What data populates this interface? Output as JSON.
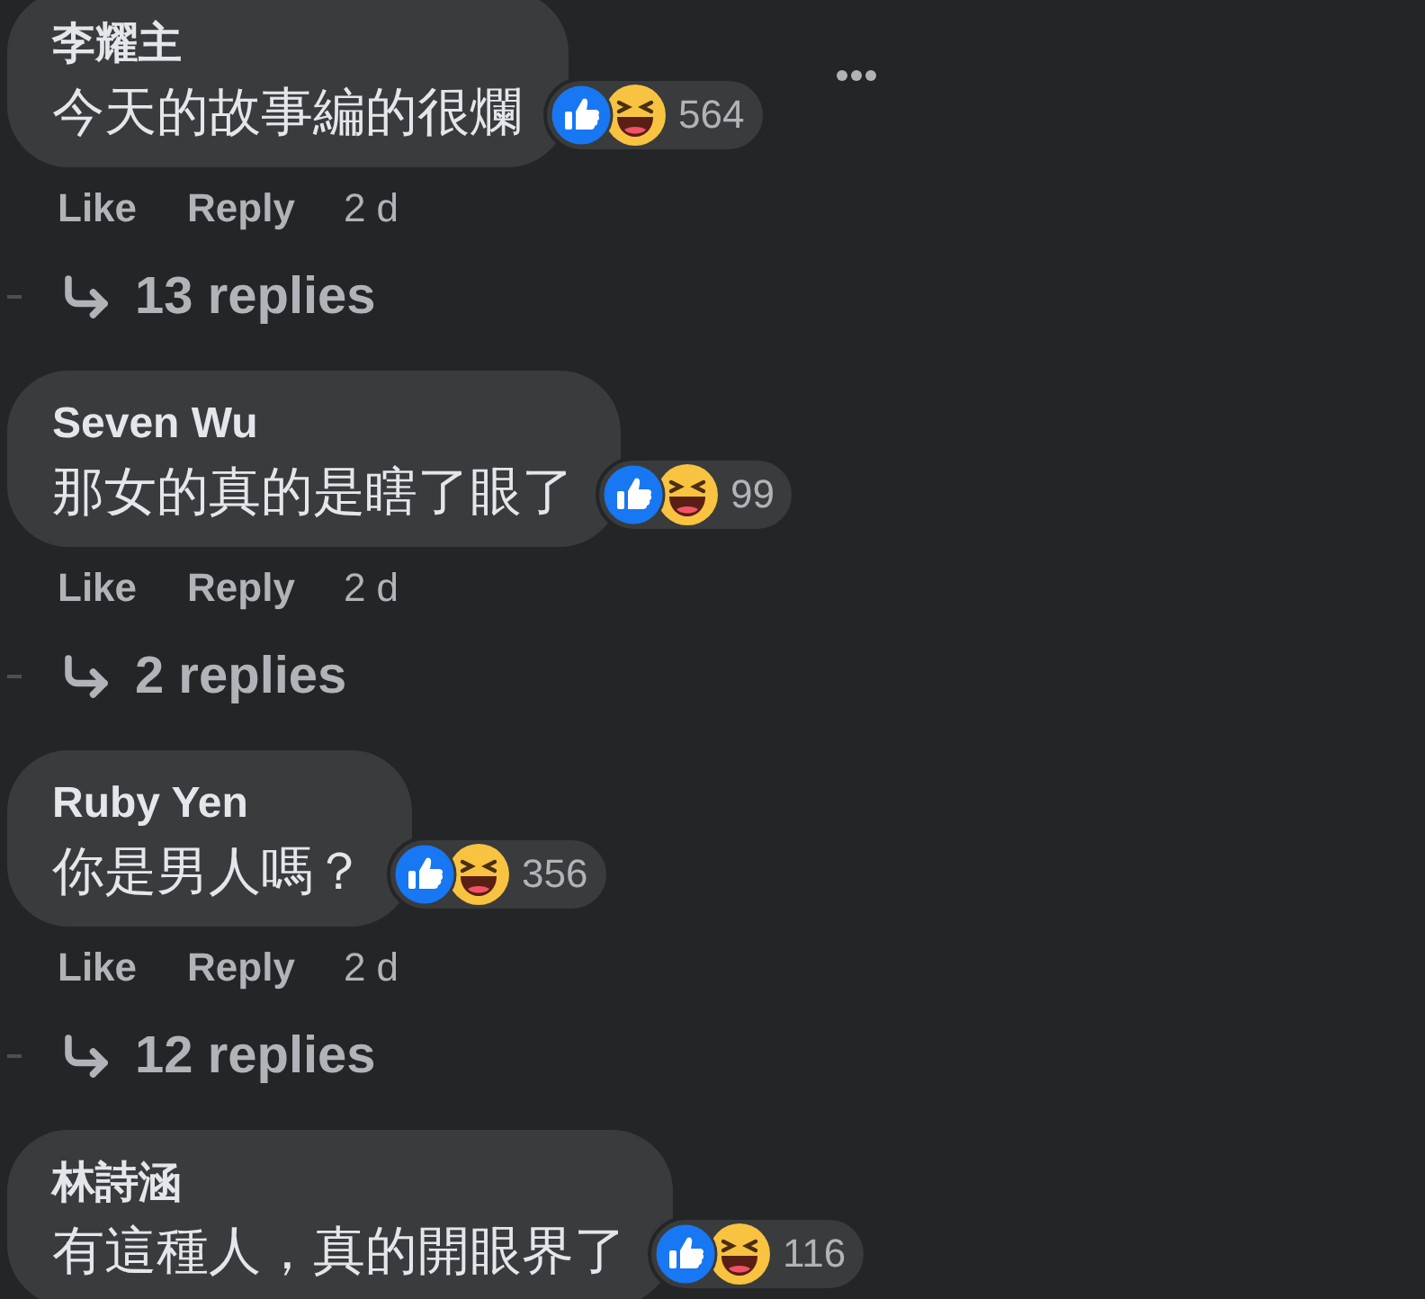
{
  "comments": [
    {
      "author": "李耀主",
      "text": "今天的故事編的很爛",
      "reaction_count": "564",
      "menu": true,
      "actions": {
        "like": "Like",
        "reply": "Reply",
        "time": "2 d"
      },
      "replies": "13 replies"
    },
    {
      "author": "Seven Wu",
      "text": "那女的真的是瞎了眼了",
      "reaction_count": "99",
      "menu": false,
      "actions": {
        "like": "Like",
        "reply": "Reply",
        "time": "2 d"
      },
      "replies": "2 replies"
    },
    {
      "author": "Ruby Yen",
      "text": "你是男人嗎？",
      "reaction_count": "356",
      "menu": false,
      "actions": {
        "like": "Like",
        "reply": "Reply",
        "time": "2 d"
      },
      "replies": "12 replies"
    },
    {
      "author": "林詩涵",
      "text": "有這種人，真的開眼界了",
      "reaction_count": "116",
      "menu": false
    }
  ]
}
